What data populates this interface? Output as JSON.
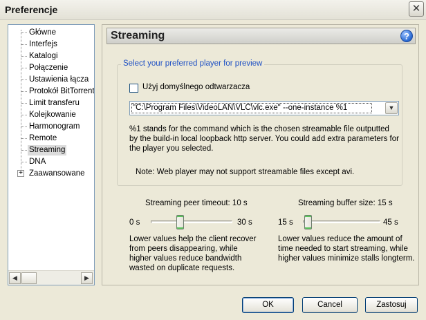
{
  "window": {
    "title": "Preferencje",
    "close_glyph": "✕"
  },
  "tree": {
    "items": [
      {
        "label": "Główne"
      },
      {
        "label": "Interfejs"
      },
      {
        "label": "Katalogi"
      },
      {
        "label": "Połączenie"
      },
      {
        "label": "Ustawienia łącza"
      },
      {
        "label": "Protokół BitTorrent"
      },
      {
        "label": "Limit transferu"
      },
      {
        "label": "Kolejkowanie"
      },
      {
        "label": "Harmonogram"
      },
      {
        "label": "Remote"
      },
      {
        "label": "Streaming",
        "selected": true
      },
      {
        "label": "DNA"
      },
      {
        "label": "Zaawansowane",
        "expandable": true,
        "expander_glyph": "+"
      }
    ],
    "scroll_left_glyph": "◀",
    "scroll_right_glyph": "▶"
  },
  "panel": {
    "title": "Streaming",
    "help_glyph": "?",
    "group": {
      "legend": "Select your preferred player for preview",
      "checkbox_label": "Użyj domyślnego odtwarzacza",
      "checkbox_checked": false,
      "player_command": "\"C:\\Program Files\\VideoLAN\\VLC\\vlc.exe\" --one-instance %1",
      "dropdown_glyph": "▼",
      "description": "%1 stands for the command which is the chosen streamable file outputted by the build-in local loopback http server. You could add extra parameters for the player you selected.",
      "note": "Note: Web player may not support streamable files except avi."
    },
    "timeout_slider": {
      "title": "Streaming peer timeout: 10 s",
      "min_label": "0 s",
      "max_label": "30 s",
      "min": 0,
      "max": 30,
      "value": 10,
      "description": "Lower values help the client recover from peers disappearing, while higher values reduce bandwidth wasted on duplicate requests."
    },
    "buffer_slider": {
      "title": "Streaming buffer size: 15 s",
      "min_label": "15 s",
      "max_label": "45 s",
      "min": 15,
      "max": 45,
      "value": 15,
      "description": "Lower values reduce the amount of time needed to start streaming, while higher values minimize stalls longterm."
    }
  },
  "buttons": {
    "ok": "OK",
    "cancel": "Cancel",
    "apply": "Zastosuj"
  },
  "colors": {
    "accent": "#1f51c4",
    "selection": "#dcdcdc"
  }
}
